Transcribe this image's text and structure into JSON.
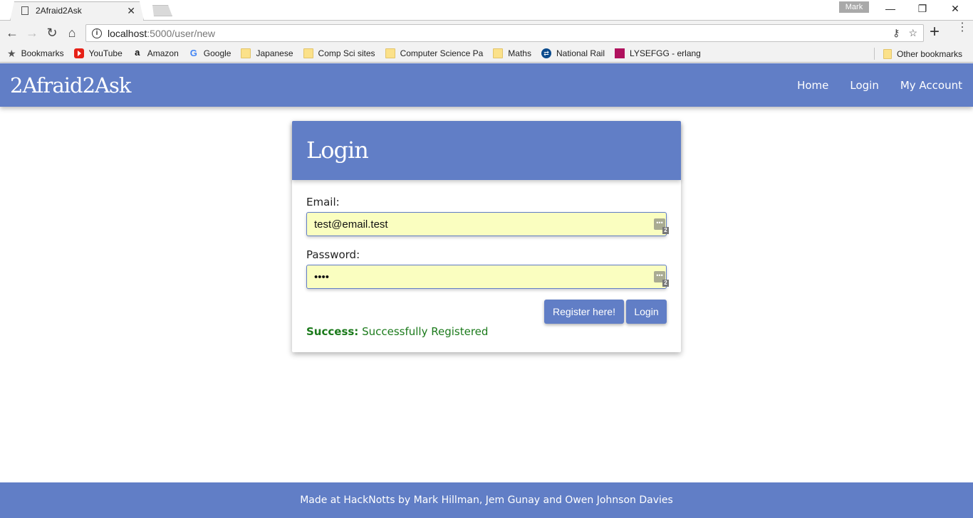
{
  "browser": {
    "tab_title": "2Afraid2Ask",
    "profile_name": "Mark",
    "url_host": "localhost",
    "url_rest": ":5000/user/new",
    "bookmarks": [
      {
        "label": "Bookmarks",
        "icon": "star-icon"
      },
      {
        "label": "YouTube",
        "icon": "youtube-icon"
      },
      {
        "label": "Amazon",
        "icon": "amazon-icon"
      },
      {
        "label": "Google",
        "icon": "google-icon"
      },
      {
        "label": "Japanese",
        "icon": "folder-icon"
      },
      {
        "label": "Comp Sci sites",
        "icon": "folder-icon"
      },
      {
        "label": "Computer Science Pa",
        "icon": "folder-icon"
      },
      {
        "label": "Maths",
        "icon": "folder-icon"
      },
      {
        "label": "National Rail",
        "icon": "national-rail-icon"
      },
      {
        "label": "LYSEFGG - erlang",
        "icon": "erlang-icon"
      }
    ],
    "other_bookmarks": "Other bookmarks"
  },
  "site": {
    "brand": "2Afraid2Ask",
    "nav": [
      "Home",
      "Login",
      "My Account"
    ],
    "accent": "#617ec6"
  },
  "login": {
    "title": "Login",
    "email_label": "Email:",
    "email_value": "test@email.test",
    "password_label": "Password:",
    "password_value": "test",
    "password_manager_count": "2",
    "register_button": "Register here!",
    "login_button": "Login",
    "status_prefix": "Success:",
    "status_text": "Successfully Registered",
    "status_color": "#1b7a1b"
  },
  "footer": {
    "text": "Made at HackNotts by Mark Hillman, Jem Gunay and Owen Johnson Davies"
  }
}
